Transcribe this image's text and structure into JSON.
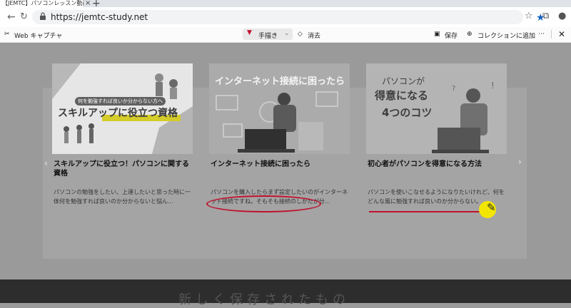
{
  "browser": {
    "tab_title": "【JEMTC】パソコンレッスン動画～もっと",
    "url": "https://jemtc-study.net"
  },
  "capture_toolbar": {
    "title": "Web キャプチャ",
    "draw": "手描き",
    "erase": "消去",
    "save": "保存",
    "add_collection": "コレクションに追加"
  },
  "cards": [
    {
      "img_top": "何を勉強すれば良いか分からない方へ",
      "img_main": "スキルアップに役立つ資格",
      "title": "スキルアップに役立つ！パソコンに関する資格",
      "desc": "パソコンの勉強をしたい、上達したいと思った時に一体何を勉強すれば良いのか分からないと悩ん..."
    },
    {
      "img_main": "インターネット接続に困ったら",
      "title": "インターネット接続に困ったら",
      "desc": "パソコンを購入したらまず設定したいのがインターネット接続ですね。そもそも接続のしかたが分..."
    },
    {
      "img_l1": "パソコンが",
      "img_l2": "得意になる",
      "img_l3": "4つのコツ",
      "title": "初心者がパソコンを得意になる方法",
      "desc": "パソコンを使いこなせるようになりたいけれど、何をどんな風に勉強すれば良いのか分からない。..."
    }
  ],
  "bottom_caption": "新しく保存されたもの",
  "colors": {
    "ink": "#c0112c",
    "highlight": "#f2e600",
    "star": "#1565c0"
  }
}
